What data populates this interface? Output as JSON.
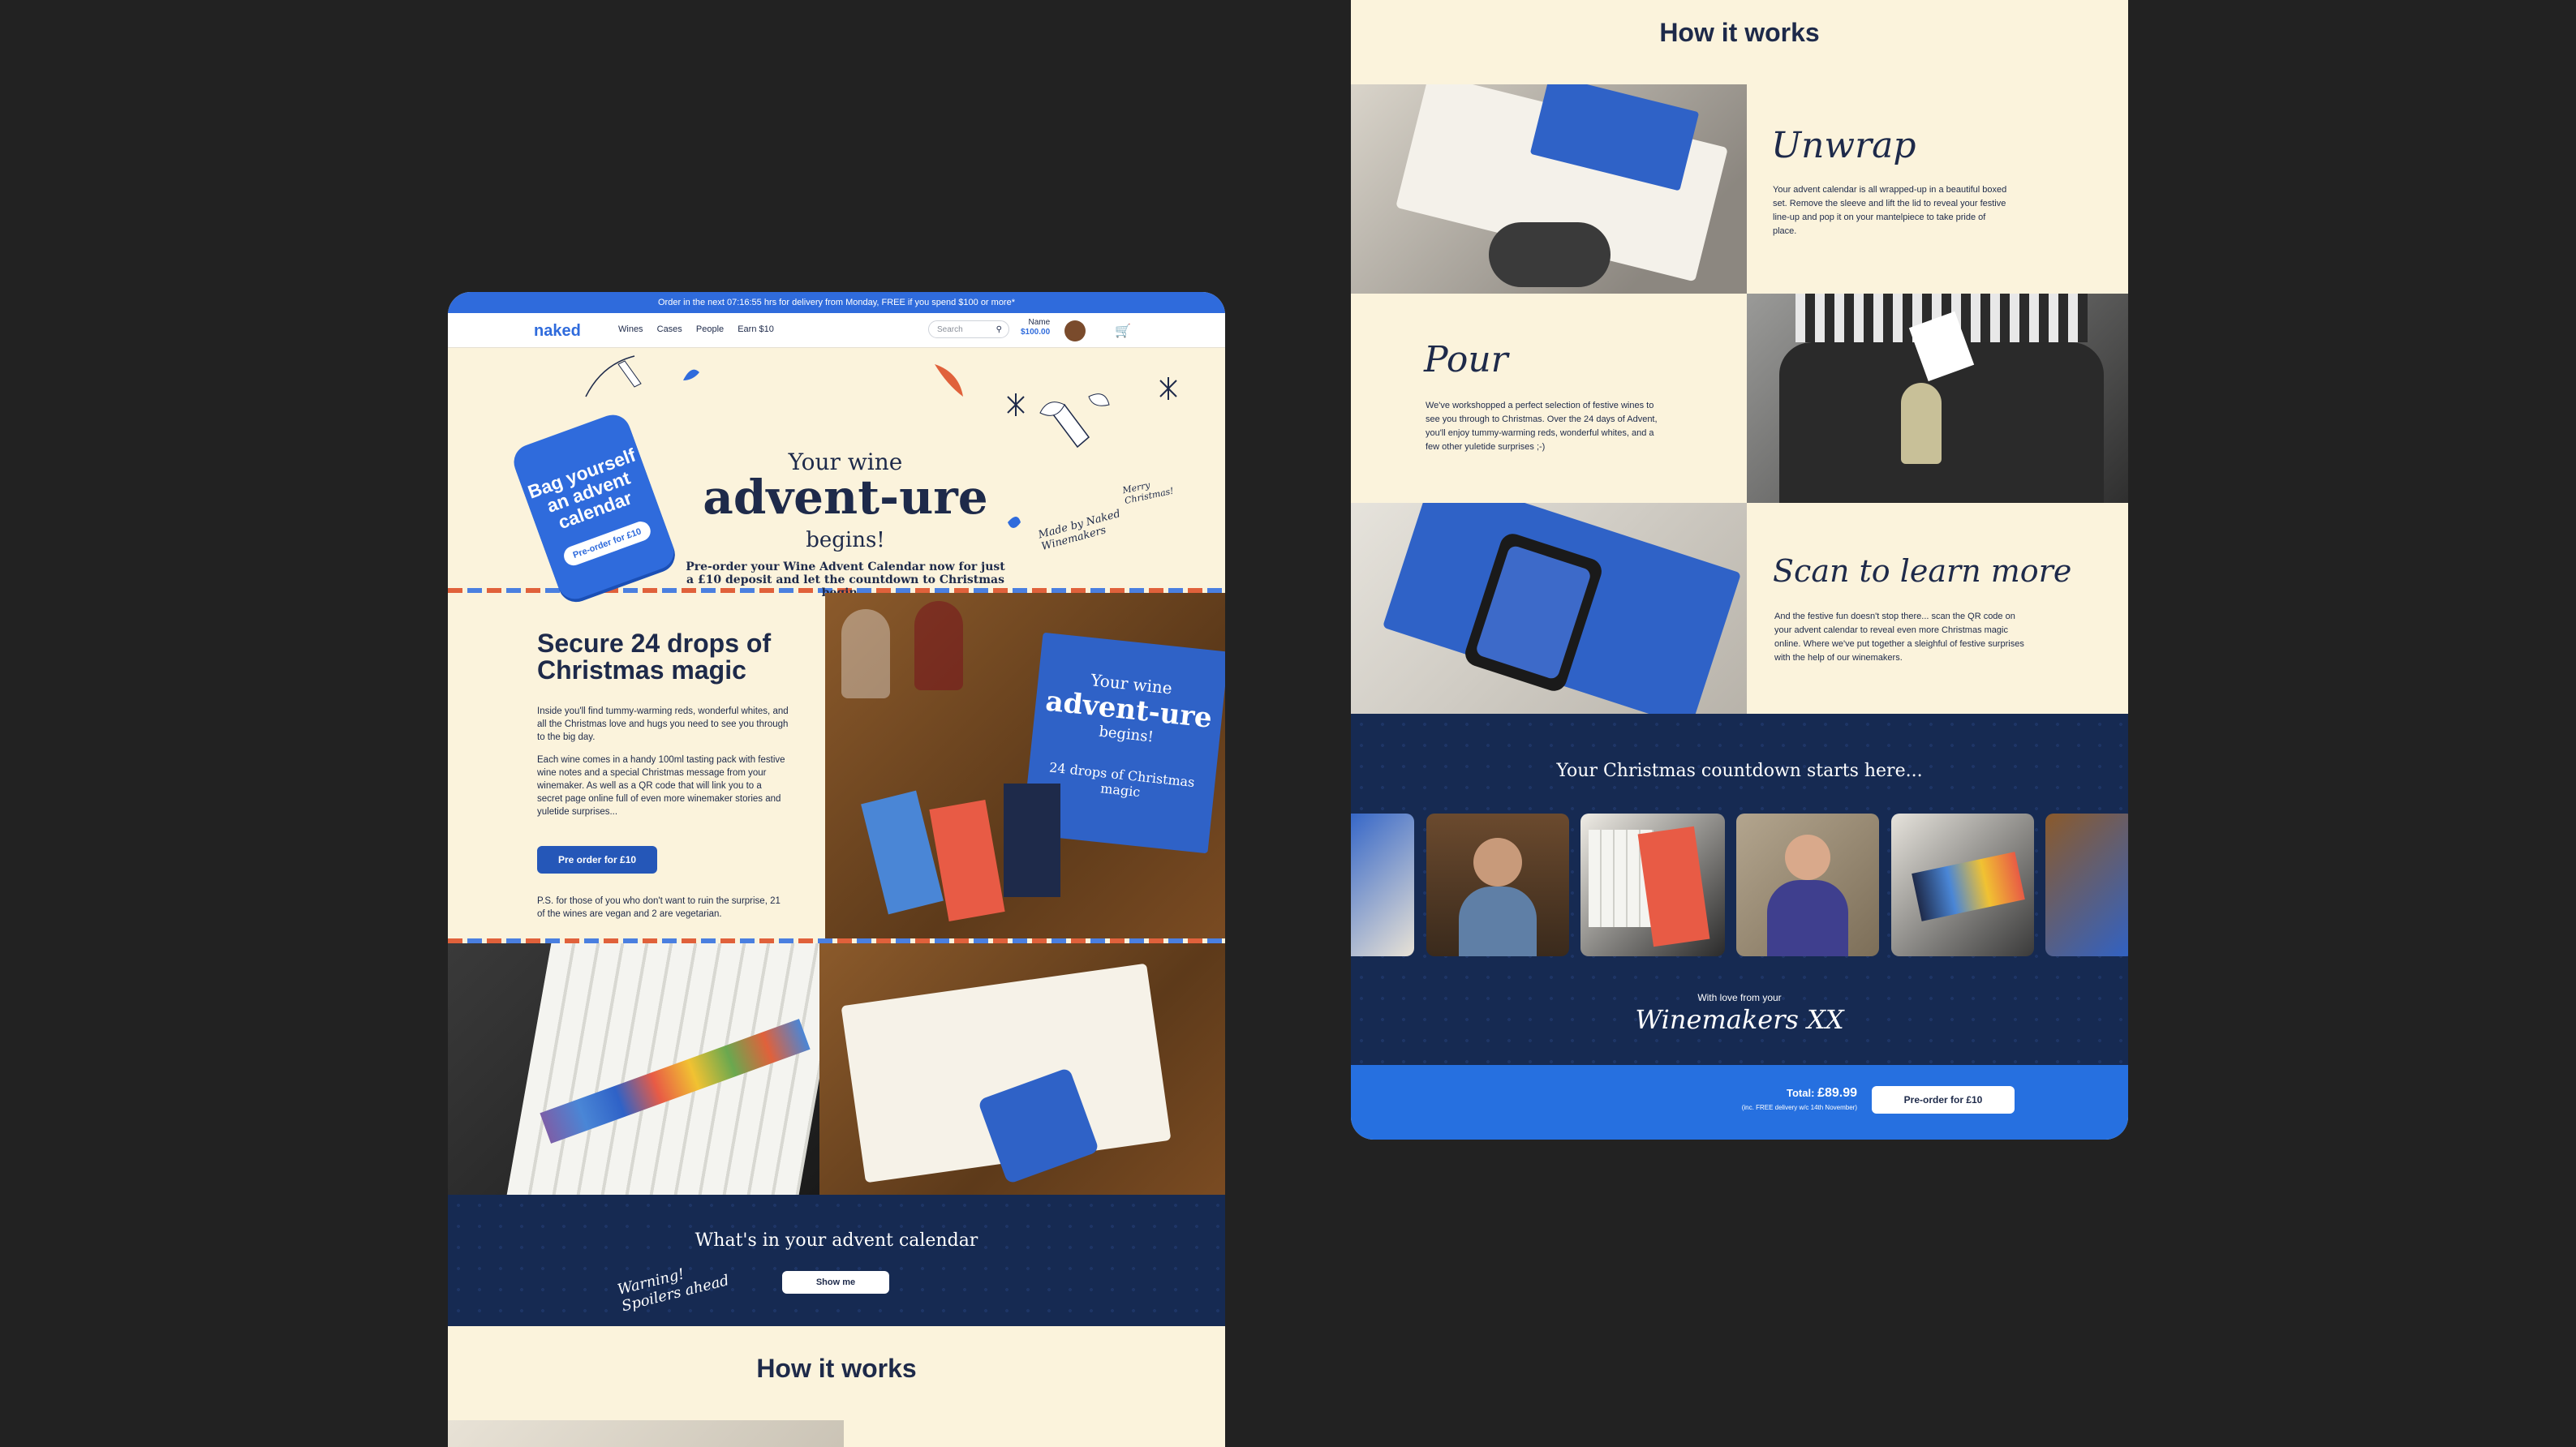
{
  "left": {
    "topbar": {
      "text": "Order in the next 07:16:55 hrs for delivery from Monday, FREE if you spend $100 or more*"
    },
    "nav": {
      "logo": "naked",
      "menu": [
        "Wines",
        "Cases",
        "People",
        "Earn $10"
      ],
      "search_placeholder": "Search",
      "account_name": "Name",
      "account_balance": "$100.00"
    },
    "hero": {
      "tag_text": "Bag yourself an advent calendar",
      "tag_button": "Pre-order for £10",
      "line1": "Your wine",
      "line2": "advent-ure",
      "line3": "begins!",
      "description": "Pre-order your Wine Advent Calendar now for just a £10 deposit and let the countdown to Christmas begin...",
      "script_note": "Made by Naked Winemakers",
      "script_merry": "Merry Christmas!"
    },
    "section1": {
      "title": "Secure 24 drops of Christmas magic",
      "p1": "Inside you'll find tummy-warming reds, wonderful whites, and all the Christmas love and hugs you need to see you through to the big day.",
      "p2": "Each wine comes in a handy 100ml tasting pack with festive wine notes and a special Christmas message from your winemaker. As well as a QR code that will link you to a secret page online full of even more winemaker stories and yuletide surprises...",
      "button": "Pre order for £10",
      "ps": "P.S. for those of you who don't want to ruin the surprise, 21 of the wines are vegan and 2 are vegetarian.",
      "box_line1": "Your wine",
      "box_line2": "advent-ure",
      "box_line3": "begins!",
      "box_side": "24 drops of Christmas magic"
    },
    "calendar_band": {
      "title": "What's in your advent calendar",
      "warning": "Warning! Spoilers ahead",
      "button": "Show me"
    },
    "how_it_works": {
      "title": "How it works"
    }
  },
  "right": {
    "title": "How it works",
    "steps": [
      {
        "heading": "Unwrap",
        "text": "Your advent calendar is all wrapped-up in a beautiful boxed set. Remove the sleeve and lift the lid to reveal your festive line-up and pop it on your mantelpiece to take pride of place."
      },
      {
        "heading": "Pour",
        "text": "We've workshopped a perfect selection of festive wines to see you through to Christmas. Over the 24 days of Advent, you'll enjoy tummy-warming reds, wonderful whites, and a few other yuletide surprises ;-)"
      },
      {
        "heading": "Scan to learn more",
        "text": "And the festive fun doesn't stop there... scan the QR code on your advent calendar to reveal even more Christmas magic online. Where we've put together a sleighful of festive surprises with the help of our winemakers."
      }
    ],
    "countdown": {
      "title": "Your Christmas countdown starts here...",
      "love_line": "With love from your",
      "signature": "Winemakers XX"
    },
    "footer": {
      "total_label": "Total:",
      "total_value": "£89.99",
      "delivery_note": "(inc. FREE delivery w/c 14th November)",
      "button": "Pre-order for £10"
    }
  },
  "colors": {
    "cream": "#fbf3dc",
    "navy": "#162a52",
    "brand_blue": "#2f6bdc",
    "background": "#222222"
  }
}
